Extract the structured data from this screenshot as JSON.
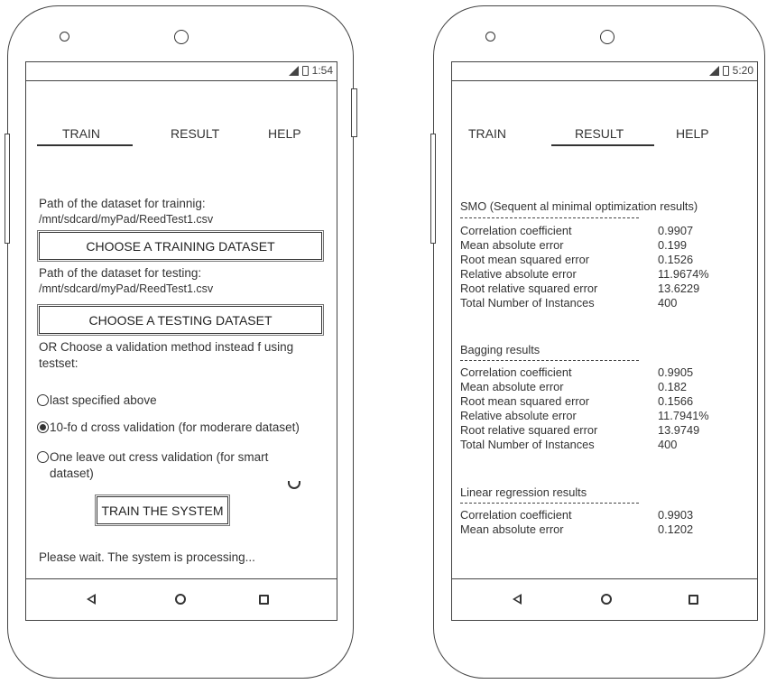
{
  "left_phone": {
    "status_time": "1:54",
    "tabs": [
      "TRAIN",
      "RESULT",
      "HELP"
    ],
    "active_tab": "TRAIN",
    "train_path_label": "Path of the dataset for trainnig:",
    "train_path_value": "/mnt/sdcard/myPad/ReedTest1.csv",
    "choose_training_button": "CHOOSE A TRAINING DATASET",
    "test_path_label": "Path of the dataset for testing:",
    "test_path_value": "/mnt/sdcard/myPad/ReedTest1.csv",
    "choose_testing_button": "CHOOSE A TESTING DATASET",
    "validation_prompt_line1": "OR Choose a validation method instead f using",
    "validation_prompt_line2": "testset:",
    "options": [
      {
        "label": "last specified above",
        "checked": false
      },
      {
        "label": "10-fo d cross validation (for moderare dataset)",
        "checked": true
      },
      {
        "label_line1": "One leave out cress validation (for smart",
        "label_line2": "dataset)",
        "checked": false
      }
    ],
    "train_button": "TRAIN THE SYSTEM",
    "status_message": "Please wait. The system is processing..."
  },
  "right_phone": {
    "status_time": "5:20",
    "tabs": [
      "TRAIN",
      "RESULT",
      "HELP"
    ],
    "active_tab": "RESULT",
    "sections": [
      {
        "title": "SMO (Sequent al minimal optimization results)",
        "rows": [
          {
            "label": "Correlation coefficient",
            "value": "0.9907"
          },
          {
            "label": "Mean absolute error",
            "value": "0.199"
          },
          {
            "label": "Root mean squared error",
            "value": "0.1526"
          },
          {
            "label": "Relative absolute error",
            "value": "11.9674%"
          },
          {
            "label": "Root relative squared error",
            "value": "13.6229"
          },
          {
            "label": "Total Number of Instances",
            "value": "400"
          }
        ]
      },
      {
        "title": "Bagging results",
        "rows": [
          {
            "label": "Correlation coefficient",
            "value": "0.9905"
          },
          {
            "label": "Mean absolute error",
            "value": "0.182"
          },
          {
            "label": "Root mean squared error",
            "value": "0.1566"
          },
          {
            "label": "Relative absolute error",
            "value": "11.7941%"
          },
          {
            "label": "Root relative squared error",
            "value": "13.9749"
          },
          {
            "label": "Total Number of Instances",
            "value": "400"
          }
        ]
      },
      {
        "title": "Linear regression results",
        "rows": [
          {
            "label": "Correlation coefficient",
            "value": "0.9903"
          },
          {
            "label": "Mean absolute error",
            "value": "0.1202"
          }
        ]
      }
    ]
  }
}
